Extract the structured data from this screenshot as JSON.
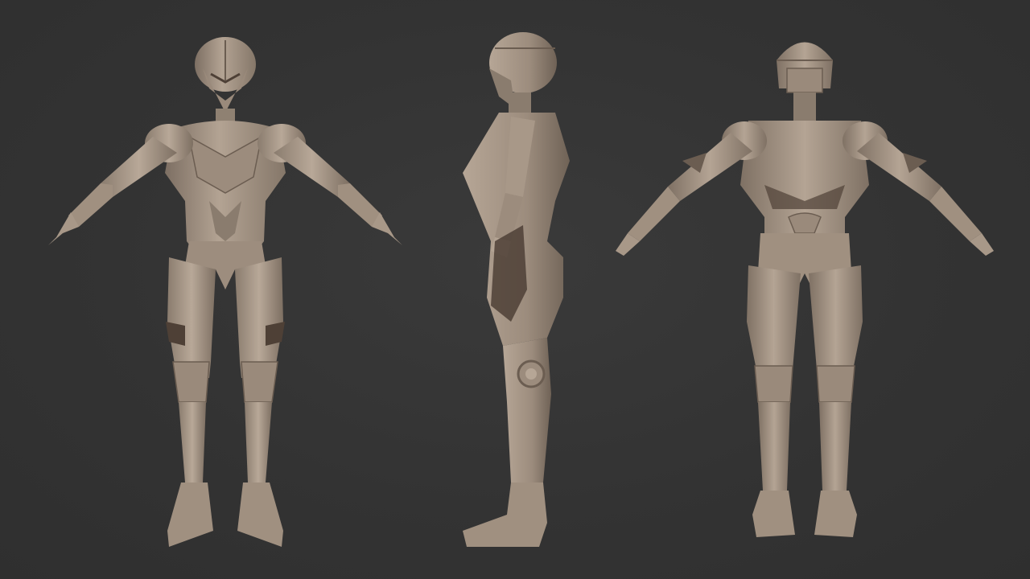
{
  "scene": {
    "background_color": "#333333",
    "model_base_color": "#a89888",
    "model_shadow_color": "#4e4036",
    "model_highlight_color": "#c9b9a8"
  },
  "views": [
    {
      "name": "front"
    },
    {
      "name": "side"
    },
    {
      "name": "back"
    }
  ]
}
